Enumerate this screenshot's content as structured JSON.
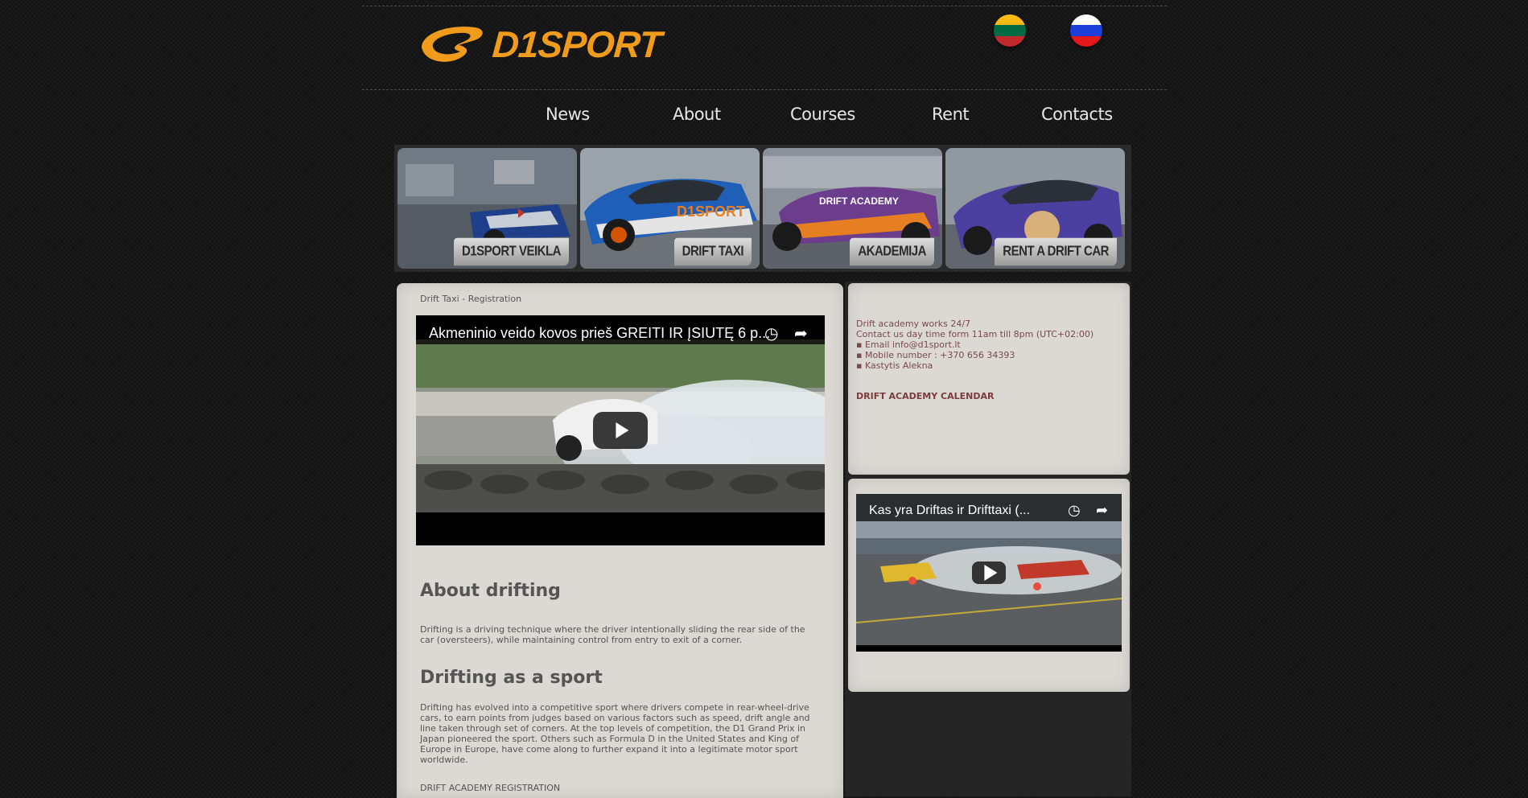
{
  "brand": {
    "name": "D1SPORT",
    "color": "#f09b1c"
  },
  "languages": [
    {
      "name": "lithuanian-flag",
      "colors": [
        "#fdb913",
        "#006a44",
        "#c1272d"
      ]
    },
    {
      "name": "russian-flag",
      "colors": [
        "#ffffff",
        "#1c3fdc",
        "#e4181c"
      ]
    }
  ],
  "nav": {
    "items": [
      "News",
      "About",
      "Courses",
      "Rent",
      "Contacts"
    ]
  },
  "banner": {
    "tiles": [
      "D1SPORT VEIKLA",
      "DRIFT TAXI",
      "AKADEMIJA",
      "RENT A DRIFT CAR"
    ]
  },
  "main": {
    "breadcrumb": "Drift Taxi - Registration",
    "video": {
      "title": "Akmeninio veido kovos prieš GREITI IR ĮSIUTĘ 6 p...",
      "icons": [
        "watch-later-icon",
        "share-icon",
        "play-icon"
      ]
    },
    "about_heading": "About drifting",
    "about_text": "Drifting is a driving technique where the driver intentionally sliding the rear side of the car (oversteers), while maintaining control from entry to exit of a corner.",
    "sport_heading": "Drifting as a sport",
    "sport_text": "Drifting has evolved into a competitive sport where drivers compete in rear-wheel-drive cars, to earn points from judges based on various factors such as speed, drift angle and line taken through set of corners. At the top levels of competition, the D1 Grand Prix in Japan pioneered the sport. Others such as Formula D in the United States and King of Europe in Europe, have come along to further expand it into a legitimate motor sport worldwide.",
    "registration_link": "DRIFT ACADEMY REGISTRATION"
  },
  "sidebar": {
    "line1": "Drift academy works 24/7",
    "line2": "Contact us day time form 11am till 8pm (UTC+02:00)",
    "email": "▪ Email info@d1sport.lt",
    "phone": "▪ Mobile number : +370 656 34393",
    "person": "▪ Kastytis Alekna",
    "calendar_link": "DRIFT ACADEMY CALENDAR",
    "video": {
      "title": "Kas yra Driftas ir Drifttaxi (..."
    }
  }
}
